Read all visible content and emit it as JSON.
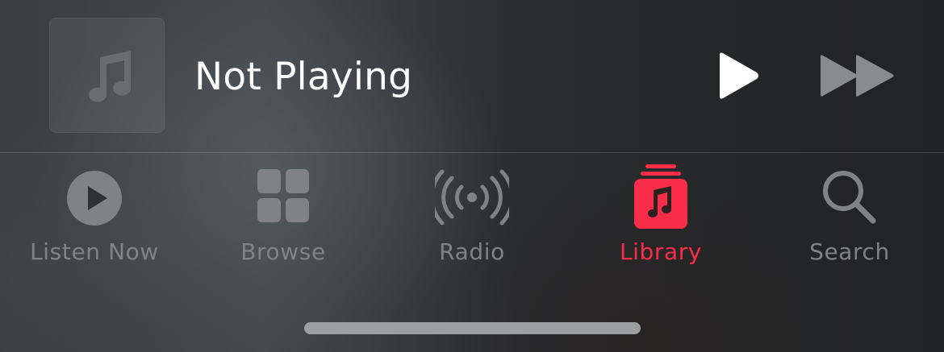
{
  "mini_player": {
    "artwork_icon": "music-note-icon",
    "title": "Not Playing",
    "controls": [
      {
        "name": "play",
        "icon": "play-icon",
        "color": "#ffffff"
      },
      {
        "name": "fast_forward",
        "icon": "fast-forward-icon",
        "color": "#8a8b8d"
      }
    ]
  },
  "tab_bar": {
    "selected": "Library",
    "accent_color": "#fa2d48",
    "inactive_color": "#808285",
    "tabs": [
      {
        "label": "Listen Now",
        "icon": "play-circle-icon"
      },
      {
        "label": "Browse",
        "icon": "grid-icon"
      },
      {
        "label": "Radio",
        "icon": "radio-broadcast-icon"
      },
      {
        "label": "Library",
        "icon": "library-music-icon"
      },
      {
        "label": "Search",
        "icon": "magnifier-icon"
      }
    ]
  }
}
